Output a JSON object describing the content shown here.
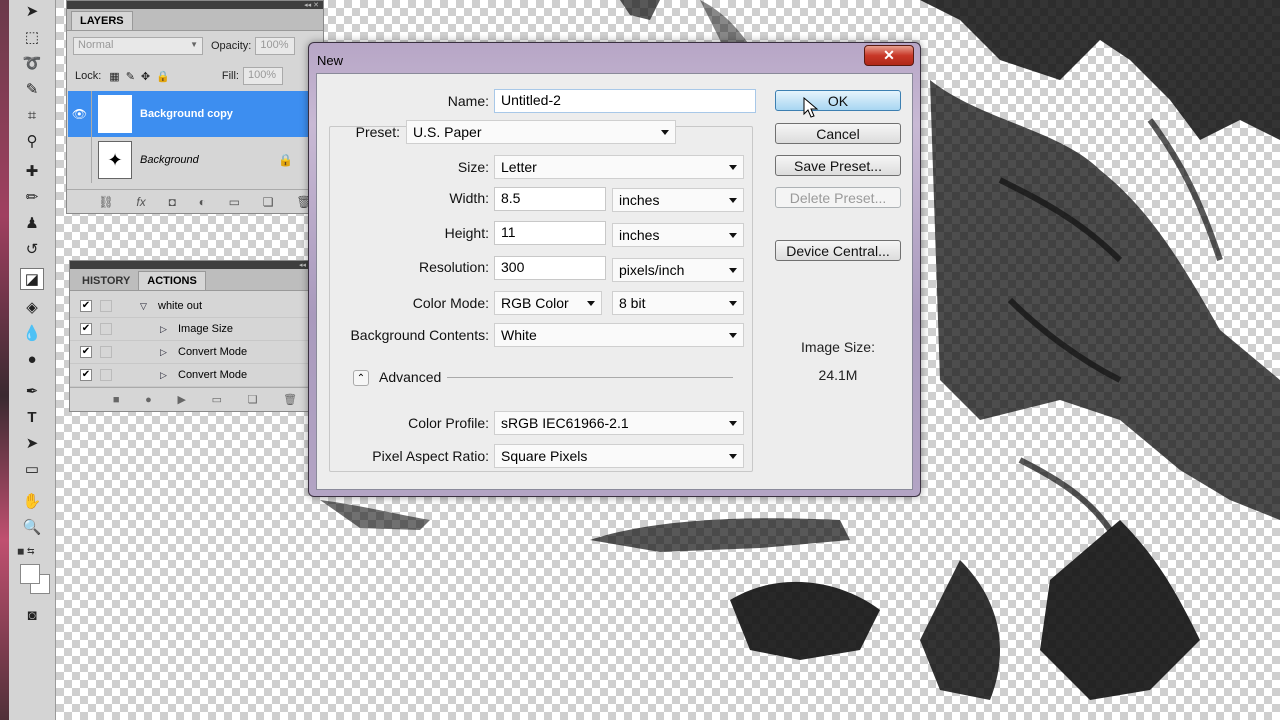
{
  "layers_panel": {
    "tab": "LAYERS",
    "blend_mode": "Normal",
    "opacity_label": "Opacity:",
    "opacity_value": "100%",
    "lock_label": "Lock:",
    "fill_label": "Fill:",
    "fill_value": "100%",
    "layers": [
      {
        "name": "Background copy",
        "selected": true,
        "visible": true
      },
      {
        "name": "Background",
        "selected": false,
        "visible": false,
        "locked": true
      }
    ],
    "bottom_icons": [
      "link-icon",
      "fx-icon",
      "mask-icon",
      "adjustment-icon",
      "group-icon",
      "new-layer-icon",
      "trash-icon"
    ]
  },
  "actions_panel": {
    "tabs": [
      "HISTORY",
      "ACTIONS"
    ],
    "active_tab": "ACTIONS",
    "items": [
      {
        "label": "white out",
        "expanded": true
      },
      {
        "label": "Image Size"
      },
      {
        "label": "Convert Mode"
      },
      {
        "label": "Convert Mode"
      }
    ],
    "bottom_icons": [
      "stop-icon",
      "record-icon",
      "play-icon",
      "new-set-icon",
      "new-action-icon",
      "trash-icon"
    ]
  },
  "dialog": {
    "title": "New",
    "close_label": "✕",
    "name_label": "Name:",
    "name_value": "Untitled-2",
    "preset_label": "Preset:",
    "preset_value": "U.S. Paper",
    "size_label": "Size:",
    "size_value": "Letter",
    "width_label": "Width:",
    "width_value": "8.5",
    "width_unit": "inches",
    "height_label": "Height:",
    "height_value": "11",
    "height_unit": "inches",
    "resolution_label": "Resolution:",
    "resolution_value": "300",
    "resolution_unit": "pixels/inch",
    "color_mode_label": "Color Mode:",
    "color_mode_value": "RGB Color",
    "bit_depth": "8 bit",
    "bg_contents_label": "Background Contents:",
    "bg_contents_value": "White",
    "advanced_label": "Advanced",
    "color_profile_label": "Color Profile:",
    "color_profile_value": "sRGB IEC61966-2.1",
    "pixel_aspect_label": "Pixel Aspect Ratio:",
    "pixel_aspect_value": "Square Pixels",
    "buttons": {
      "ok": "OK",
      "cancel": "Cancel",
      "save_preset": "Save Preset...",
      "delete_preset": "Delete Preset...",
      "device_central": "Device Central..."
    },
    "image_size_label": "Image Size:",
    "image_size_value": "24.1M"
  }
}
